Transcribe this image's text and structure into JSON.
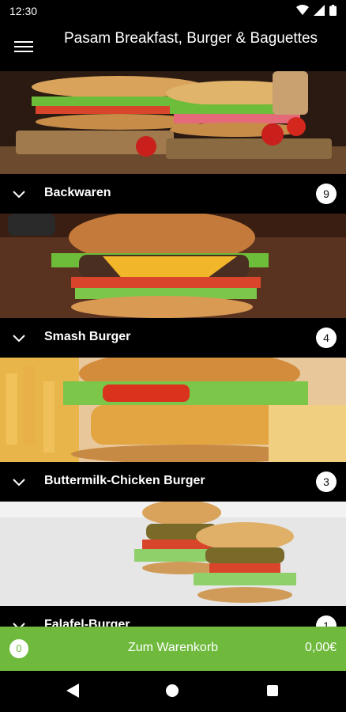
{
  "status": {
    "time": "12:30"
  },
  "header": {
    "title": "Pasam Breakfast, Burger & Baguettes"
  },
  "categories": [
    {
      "label": "Backwaren",
      "count": "9"
    },
    {
      "label": "Smash Burger",
      "count": "4"
    },
    {
      "label": "Buttermilk-Chicken Burger",
      "count": "3"
    },
    {
      "label": "Falafel-Burger",
      "count": "1"
    }
  ],
  "cart": {
    "count": "0",
    "label": "Zum Warenkorb",
    "total": "0,00€"
  },
  "colors": {
    "accent": "#6fba3d",
    "background": "#000000"
  }
}
